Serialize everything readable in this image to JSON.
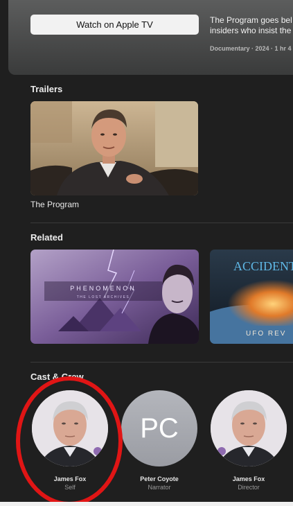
{
  "hero": {
    "watch_label": "Watch on Apple TV",
    "description_line1": "The Program goes bel",
    "description_line2": "insiders who insist the",
    "meta": "Documentary · 2024 · 1 hr 4"
  },
  "trailers": {
    "title": "Trailers",
    "items": [
      {
        "label": "The Program"
      }
    ]
  },
  "related": {
    "title": "Related",
    "items": [
      {
        "title": "PHENOMENON",
        "subtitle": "THE LOST ARCHIVES"
      },
      {
        "title": "ACCIDENT",
        "subtitle": "UFO REV"
      }
    ]
  },
  "cast": {
    "title": "Cast & Crew",
    "items": [
      {
        "name": "James Fox",
        "role": "Self"
      },
      {
        "name": "Peter Coyote",
        "role": "Narrator",
        "initials": "PC"
      },
      {
        "name": "James Fox",
        "role": "Director"
      }
    ]
  },
  "colors": {
    "background": "#1f1f1f",
    "highlight": "#e01515",
    "button_bg": "#f2f2f2"
  }
}
